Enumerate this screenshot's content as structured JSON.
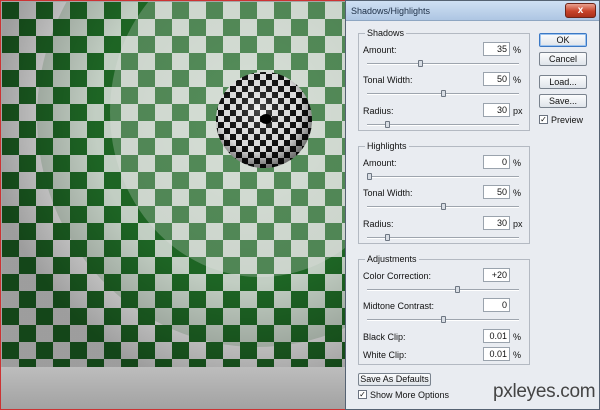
{
  "dialog": {
    "title": "Shadows/Highlights",
    "close_glyph": "x"
  },
  "shadows": {
    "legend": "Shadows",
    "amount": {
      "label": "Amount:",
      "value": "35",
      "unit": "%",
      "level": 0.35
    },
    "tonal_width": {
      "label": "Tonal Width:",
      "value": "50",
      "unit": "%",
      "level": 0.5
    },
    "radius": {
      "label": "Radius:",
      "value": "30",
      "unit": "px",
      "level": 0.12
    }
  },
  "highlights": {
    "legend": "Highlights",
    "amount": {
      "label": "Amount:",
      "value": "0",
      "unit": "%",
      "level": 0.0
    },
    "tonal_width": {
      "label": "Tonal Width:",
      "value": "50",
      "unit": "%",
      "level": 0.5
    },
    "radius": {
      "label": "Radius:",
      "value": "30",
      "unit": "px",
      "level": 0.12
    }
  },
  "adjustments": {
    "legend": "Adjustments",
    "color_correction": {
      "label": "Color Correction:",
      "value": "+20",
      "level": 0.6
    },
    "midtone_contrast": {
      "label": "Midtone Contrast:",
      "value": "0",
      "level": 0.5
    },
    "black_clip": {
      "label": "Black Clip:",
      "value": "0.01",
      "unit": "%"
    },
    "white_clip": {
      "label": "White Clip:",
      "value": "0.01",
      "unit": "%"
    }
  },
  "buttons": {
    "ok": "OK",
    "cancel": "Cancel",
    "load": "Load...",
    "save": "Save...",
    "save_defaults": "Save As Defaults"
  },
  "preview": {
    "label": "Preview",
    "checked": true
  },
  "show_more": {
    "label": "Show More Options",
    "checked": true
  },
  "watermark": {
    "main": "pxleyes",
    "suffix": ".com"
  },
  "colors": {
    "checker_dark": "#1f6b26",
    "checker_light": "#f2f2f2",
    "dialog_bg": "#e9ecf1"
  }
}
